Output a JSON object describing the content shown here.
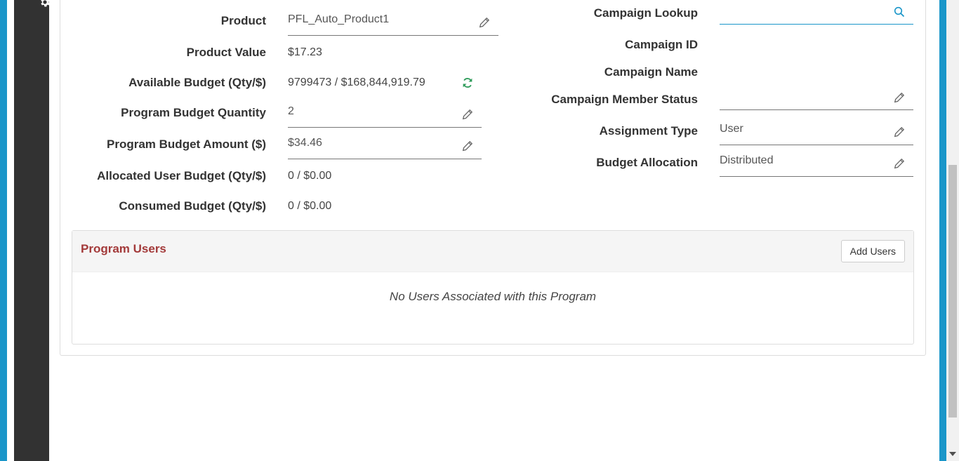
{
  "left": {
    "product_label": "Product",
    "product_value": "PFL_Auto_Product1",
    "product_value_label": "Product Value",
    "product_value_value": "$17.23",
    "available_budget_label": "Available Budget (Qty/$)",
    "available_budget_value": "9799473 / $168,844,919.79",
    "program_budget_qty_label": "Program Budget Quantity",
    "program_budget_qty_value": "2",
    "program_budget_amt_label": "Program Budget Amount ($)",
    "program_budget_amt_value": "$34.46",
    "allocated_user_budget_label": "Allocated User Budget (Qty/$)",
    "allocated_user_budget_value": "0 / $0.00",
    "consumed_budget_label": "Consumed Budget (Qty/$)",
    "consumed_budget_value": "0 / $0.00"
  },
  "right": {
    "campaign_lookup_label": "Campaign Lookup",
    "campaign_lookup_value": "",
    "campaign_id_label": "Campaign ID",
    "campaign_name_label": "Campaign Name",
    "campaign_member_status_label": "Campaign Member Status",
    "campaign_member_status_value": "",
    "assignment_type_label": "Assignment Type",
    "assignment_type_value": "User",
    "budget_allocation_label": "Budget Allocation",
    "budget_allocation_value": "Distributed"
  },
  "program_users": {
    "title": "Program Users",
    "add_button": "Add Users",
    "empty_message": "No Users Associated with this Program"
  },
  "colors": {
    "accent_blue": "#1a96c9",
    "title_red": "#a33a3a",
    "refresh_green": "#2e9b5a"
  }
}
